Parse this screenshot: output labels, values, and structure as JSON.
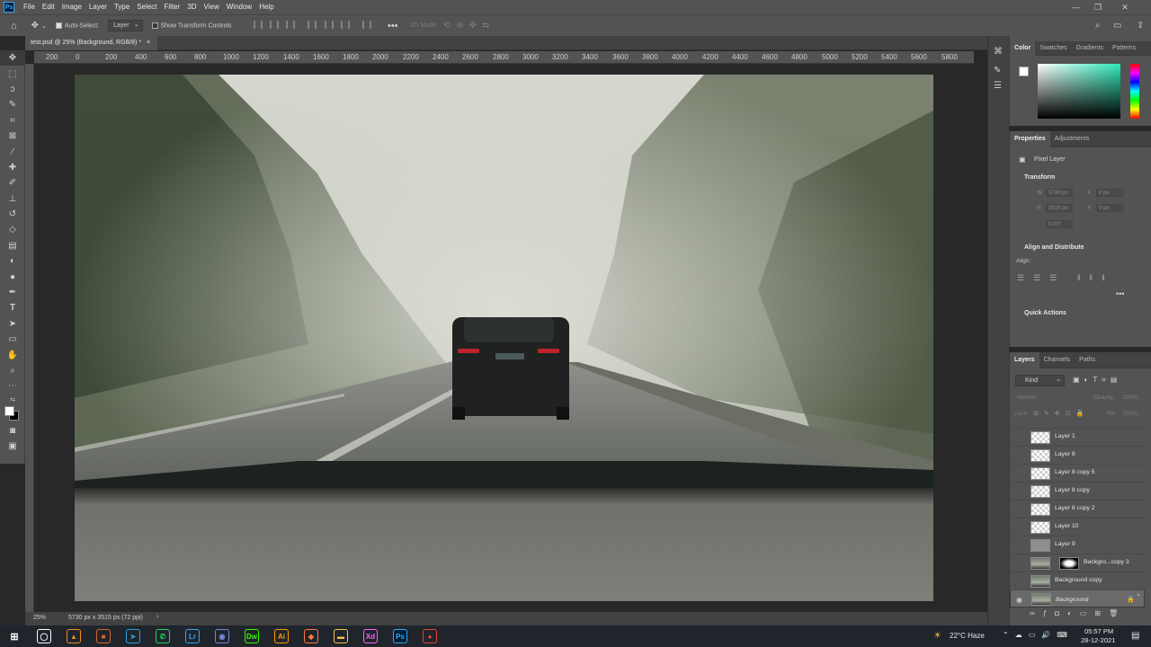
{
  "menubar": {
    "items": [
      "File",
      "Edit",
      "Image",
      "Layer",
      "Type",
      "Select",
      "Filter",
      "3D",
      "View",
      "Window",
      "Help"
    ]
  },
  "options": {
    "auto_select_label": "Auto-Select:",
    "auto_select_value": "Layer",
    "show_transform_label": "Show Transform Controls",
    "mode_3d_label": "3D Mode:"
  },
  "document": {
    "tab_title": "test.psd @ 25% (Background, RGB/8) *"
  },
  "ruler": {
    "ticks": [
      "200",
      "0",
      "200",
      "400",
      "600",
      "800",
      "1000",
      "1200",
      "1400",
      "1600",
      "1800",
      "2000",
      "2200",
      "2400",
      "2600",
      "2800",
      "3000",
      "3200",
      "3400",
      "3600",
      "3800",
      "4000",
      "4200",
      "4400",
      "4600",
      "4800",
      "5000",
      "5200",
      "5400",
      "5600",
      "5800"
    ]
  },
  "status": {
    "zoom": "25%",
    "doc_info": "5730 px x 3515 px (72 ppi)"
  },
  "color_panel": {
    "tabs": [
      "Color",
      "Swatches",
      "Gradients",
      "Patterns"
    ]
  },
  "properties": {
    "tabs": [
      "Properties",
      "Adjustments"
    ],
    "layer_type": "Pixel Layer",
    "transform_label": "Transform",
    "w_label": "W",
    "w_value": "5730 px",
    "x_label": "X",
    "x_value": "0 px",
    "h_label": "H",
    "h_value": "3515 px",
    "y_label": "Y",
    "y_value": "0 px",
    "angle_value": "0.00°",
    "align_label": "Align and Distribute",
    "align_sub": "Align:",
    "quick_actions_label": "Quick Actions"
  },
  "layers_panel": {
    "tabs": [
      "Layers",
      "Channels",
      "Paths"
    ],
    "filter_kind": "Kind",
    "blend_mode": "Normal",
    "opacity_label": "Opacity:",
    "opacity_value": "100%",
    "lock_label": "Lock:",
    "fill_label": "Fill:",
    "fill_value": "100%",
    "layers": [
      {
        "name": "Layer 1",
        "thumb": "transparent"
      },
      {
        "name": "Layer 8",
        "thumb": "transparent"
      },
      {
        "name": "Layer 8 copy 5",
        "thumb": "transparent"
      },
      {
        "name": "Layer 8 copy",
        "thumb": "transparent"
      },
      {
        "name": "Layer 8 copy 2",
        "thumb": "transparent"
      },
      {
        "name": "Layer 10",
        "thumb": "transparent"
      },
      {
        "name": "Layer 9",
        "thumb": "gray"
      },
      {
        "name": "Backgro...copy 3",
        "thumb": "photo-masked"
      },
      {
        "name": "Background copy",
        "thumb": "photo"
      },
      {
        "name": "Background",
        "thumb": "photo"
      }
    ]
  },
  "taskbar": {
    "weather": "22°C  Haze",
    "time": "05:57 PM",
    "date": "28-12-2021",
    "apps": [
      {
        "name": "cortana",
        "glyph": "◯",
        "color": "#ffffff"
      },
      {
        "name": "vlc",
        "glyph": "▲",
        "color": "#f28c1e"
      },
      {
        "name": "app-red",
        "glyph": "■",
        "color": "#d4662e"
      },
      {
        "name": "telegram",
        "glyph": "➤",
        "color": "#2aa1da"
      },
      {
        "name": "whatsapp",
        "glyph": "✆",
        "color": "#25d366"
      },
      {
        "name": "lightroom",
        "glyph": "Lr",
        "color": "#31a8ff"
      },
      {
        "name": "discord",
        "glyph": "◉",
        "color": "#7289da"
      },
      {
        "name": "dreamweaver",
        "glyph": "Dw",
        "color": "#35fa00"
      },
      {
        "name": "illustrator",
        "glyph": "Ai",
        "color": "#ff9a00"
      },
      {
        "name": "app-orange",
        "glyph": "◆",
        "color": "#ff7a3d"
      },
      {
        "name": "file-explorer",
        "glyph": "▬",
        "color": "#f6c343"
      },
      {
        "name": "xd",
        "glyph": "Xd",
        "color": "#ff61f6"
      },
      {
        "name": "photoshop",
        "glyph": "Ps",
        "color": "#31a8ff"
      },
      {
        "name": "chrome",
        "glyph": "●",
        "color": "#ea4335"
      }
    ]
  }
}
